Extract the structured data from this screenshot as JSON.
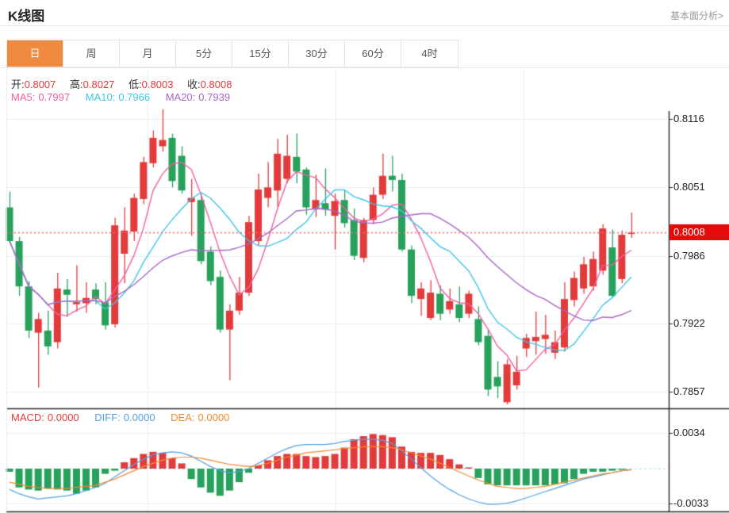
{
  "header": {
    "title": "K线图",
    "analysis_link": "基本面分析>"
  },
  "tabs": [
    {
      "label": "日",
      "active": true
    },
    {
      "label": "周",
      "active": false
    },
    {
      "label": "月",
      "active": false
    },
    {
      "label": "5分",
      "active": false
    },
    {
      "label": "15分",
      "active": false
    },
    {
      "label": "30分",
      "active": false
    },
    {
      "label": "60分",
      "active": false
    },
    {
      "label": "4时",
      "active": false
    }
  ],
  "readout": {
    "open_label": "开:",
    "open": "0.8007",
    "high_label": "高:",
    "high": "0.8027",
    "low_label": "低:",
    "low": "0.8003",
    "close_label": "收:",
    "close": "0.8008",
    "ma5_label": "MA5:",
    "ma5": "0.7997",
    "ma10_label": "MA10:",
    "ma10": "0.7966",
    "ma20_label": "MA20:",
    "ma20": "0.7939"
  },
  "macd_readout": {
    "macd_label": "MACD:",
    "macd": "0.0000",
    "diff_label": "DIFF:",
    "diff": "0.0000",
    "dea_label": "DEA:",
    "dea": "0.0000"
  },
  "colors": {
    "up": "#e23b3b",
    "down": "#27a15b",
    "ma5": "#f25fa5",
    "ma10": "#3ec6e8",
    "ma20": "#a866c8",
    "diff": "#55a0e0",
    "dea": "#f08a2c",
    "badge": "#e60b0b",
    "dotted_line": "#f56a6a",
    "grid": "#e7eef5",
    "zero_dash": "#aed6e8",
    "axis": "#333333",
    "frame": "#2b2b2b",
    "tab_active": "#ef8a3e",
    "link": "#999999"
  },
  "chart_data": {
    "type": "candlestick+macd",
    "title": "K线图",
    "legend": [
      "MA5",
      "MA10",
      "MA20",
      "MACD",
      "DIFF",
      "DEA"
    ],
    "grid": true,
    "price_axis_side": "right",
    "price_ticks": [
      {
        "label": "0.8116",
        "value": 0.8116
      },
      {
        "label": "0.8051",
        "value": 0.8051
      },
      {
        "label": "0.7986",
        "value": 0.7986
      },
      {
        "label": "0.7922",
        "value": 0.7922
      },
      {
        "label": "0.7857",
        "value": 0.7857
      }
    ],
    "last_price": {
      "label": "0.8008",
      "value": 0.8008
    },
    "macd_ticks": [
      {
        "label": "0.0034",
        "value": 0.0034
      },
      {
        "label": "-0.0033",
        "value": -0.0033
      }
    ],
    "ma_periods": [
      5,
      10,
      20
    ],
    "candles": [
      [
        0.8032,
        0.8047,
        0.7998,
        0.8
      ],
      [
        0.8,
        0.8004,
        0.7948,
        0.7957
      ],
      [
        0.7957,
        0.7962,
        0.7908,
        0.7915
      ],
      [
        0.7913,
        0.7932,
        0.7861,
        0.7926
      ],
      [
        0.7915,
        0.7934,
        0.7892,
        0.79
      ],
      [
        0.7904,
        0.797,
        0.7898,
        0.7955
      ],
      [
        0.7954,
        0.7964,
        0.7928,
        0.7949
      ],
      [
        0.794,
        0.7977,
        0.7933,
        0.7942
      ],
      [
        0.7941,
        0.7961,
        0.7932,
        0.7946
      ],
      [
        0.7954,
        0.796,
        0.794,
        0.7945
      ],
      [
        0.7942,
        0.7961,
        0.7916,
        0.792
      ],
      [
        0.7921,
        0.8022,
        0.7918,
        0.8015
      ],
      [
        0.7988,
        0.8032,
        0.796,
        0.801
      ],
      [
        0.8009,
        0.8045,
        0.8,
        0.8041
      ],
      [
        0.804,
        0.808,
        0.8035,
        0.8075
      ],
      [
        0.8074,
        0.8105,
        0.807,
        0.8098
      ],
      [
        0.809,
        0.8125,
        0.8085,
        0.8096
      ],
      [
        0.8098,
        0.8102,
        0.8051,
        0.8057
      ],
      [
        0.8081,
        0.809,
        0.8045,
        0.8048
      ],
      [
        0.8037,
        0.8059,
        0.8005,
        0.8041
      ],
      [
        0.8039,
        0.8045,
        0.7978,
        0.7981
      ],
      [
        0.799,
        0.7995,
        0.7958,
        0.7962
      ],
      [
        0.7966,
        0.7972,
        0.7913,
        0.7916
      ],
      [
        0.7916,
        0.794,
        0.7868,
        0.7934
      ],
      [
        0.7934,
        0.7966,
        0.793,
        0.7951
      ],
      [
        0.7951,
        0.8024,
        0.7948,
        0.8018
      ],
      [
        0.8,
        0.8064,
        0.7996,
        0.8049
      ],
      [
        0.8041,
        0.8075,
        0.8032,
        0.8051
      ],
      [
        0.8048,
        0.8097,
        0.8032,
        0.8083
      ],
      [
        0.8059,
        0.8101,
        0.8055,
        0.8081
      ],
      [
        0.808,
        0.8102,
        0.8055,
        0.8066
      ],
      [
        0.8068,
        0.807,
        0.8025,
        0.8032
      ],
      [
        0.803,
        0.8063,
        0.8023,
        0.8039
      ],
      [
        0.8036,
        0.8069,
        0.8024,
        0.803
      ],
      [
        0.8024,
        0.8045,
        0.7992,
        0.8038
      ],
      [
        0.8039,
        0.8048,
        0.8013,
        0.8017
      ],
      [
        0.802,
        0.8031,
        0.7982,
        0.7986
      ],
      [
        0.7984,
        0.8022,
        0.798,
        0.802
      ],
      [
        0.802,
        0.8051,
        0.8016,
        0.8044
      ],
      [
        0.8044,
        0.8083,
        0.804,
        0.8062
      ],
      [
        0.8062,
        0.8081,
        0.8047,
        0.8058
      ],
      [
        0.8058,
        0.8064,
        0.799,
        0.7992
      ],
      [
        0.7992,
        0.7996,
        0.7941,
        0.7948
      ],
      [
        0.7945,
        0.7961,
        0.7929,
        0.7955
      ],
      [
        0.7927,
        0.7963,
        0.7925,
        0.7951
      ],
      [
        0.795,
        0.7958,
        0.7925,
        0.7931
      ],
      [
        0.7935,
        0.7955,
        0.7931,
        0.7943
      ],
      [
        0.794,
        0.7957,
        0.7923,
        0.7927
      ],
      [
        0.7931,
        0.7953,
        0.7927,
        0.795
      ],
      [
        0.7926,
        0.7938,
        0.7901,
        0.7904
      ],
      [
        0.791,
        0.7916,
        0.7853,
        0.7859
      ],
      [
        0.7871,
        0.7886,
        0.7851,
        0.7862
      ],
      [
        0.7847,
        0.7888,
        0.7845,
        0.7883
      ],
      [
        0.7863,
        0.7891,
        0.7859,
        0.7876
      ],
      [
        0.7898,
        0.7912,
        0.789,
        0.7908
      ],
      [
        0.7905,
        0.7933,
        0.7892,
        0.7909
      ],
      [
        0.7907,
        0.793,
        0.7893,
        0.7911
      ],
      [
        0.7894,
        0.7915,
        0.7888,
        0.7904
      ],
      [
        0.7899,
        0.7961,
        0.7895,
        0.7945
      ],
      [
        0.7944,
        0.7971,
        0.7938,
        0.7965
      ],
      [
        0.7955,
        0.7985,
        0.795,
        0.7978
      ],
      [
        0.7957,
        0.799,
        0.7953,
        0.7983
      ],
      [
        0.7972,
        0.8016,
        0.7968,
        0.8012
      ],
      [
        0.7994,
        0.8011,
        0.7946,
        0.7948
      ],
      [
        0.7964,
        0.801,
        0.796,
        0.8006
      ],
      [
        0.8007,
        0.8027,
        0.8003,
        0.8008
      ]
    ],
    "macd": {
      "hist": [
        -0.0003,
        -0.0018,
        -0.002,
        -0.0021,
        -0.0019,
        -0.002,
        -0.0021,
        -0.0024,
        -0.0021,
        -0.0018,
        -0.0005,
        -0.0002,
        0.0006,
        0.001,
        0.0014,
        0.0016,
        0.0015,
        0.001,
        0.0005,
        -0.001,
        -0.0018,
        -0.0023,
        -0.0026,
        -0.0021,
        -0.0013,
        -0.0004,
        0.0003,
        0.0008,
        0.0012,
        0.0014,
        0.0014,
        0.0012,
        0.0011,
        0.0012,
        0.0014,
        0.002,
        0.0028,
        0.0031,
        0.0033,
        0.0032,
        0.003,
        0.0021,
        0.0016,
        0.0015,
        0.0015,
        0.0013,
        0.0009,
        0.0004,
        0.0001,
        -0.0009,
        -0.0015,
        -0.0016,
        -0.0016,
        -0.0016,
        -0.0016,
        -0.0016,
        -0.0016,
        -0.0015,
        -0.0014,
        -0.001,
        -0.0005,
        -0.0003,
        -0.0003,
        -0.0002,
        -0.0001,
        0.0
      ],
      "diff": [
        -0.002,
        -0.0024,
        -0.0027,
        -0.0029,
        -0.0028,
        -0.0027,
        -0.0026,
        -0.0024,
        -0.0021,
        -0.0018,
        -0.0014,
        -0.0008,
        -0.0002,
        0.0004,
        0.0009,
        0.0013,
        0.0015,
        0.0016,
        0.0015,
        0.0012,
        0.0007,
        0.0002,
        -0.0002,
        -0.0004,
        -0.0003,
        0.0,
        0.0005,
        0.001,
        0.0015,
        0.0019,
        0.0022,
        0.0023,
        0.0023,
        0.0023,
        0.0024,
        0.0026,
        0.0027,
        0.0028,
        0.0028,
        0.0027,
        0.0024,
        0.0017,
        0.0009,
        0.0001,
        -0.0007,
        -0.0014,
        -0.002,
        -0.0025,
        -0.0029,
        -0.0032,
        -0.0034,
        -0.0034,
        -0.0033,
        -0.0031,
        -0.0028,
        -0.0025,
        -0.0022,
        -0.0019,
        -0.0016,
        -0.0013,
        -0.001,
        -0.0008,
        -0.0006,
        -0.0004,
        -0.0002,
        -0.0001
      ],
      "dea": [
        -0.0013,
        -0.0015,
        -0.0017,
        -0.0018,
        -0.0019,
        -0.0019,
        -0.0019,
        -0.0018,
        -0.0017,
        -0.0016,
        -0.0013,
        -0.001,
        -0.0006,
        -0.0002,
        0.0002,
        0.0005,
        0.0008,
        0.001,
        0.0011,
        0.0011,
        0.001,
        0.0008,
        0.0006,
        0.0004,
        0.0003,
        0.0002,
        0.0003,
        0.0005,
        0.0008,
        0.0011,
        0.0013,
        0.0015,
        0.0016,
        0.0017,
        0.0018,
        0.0019,
        0.002,
        0.0021,
        0.0021,
        0.0021,
        0.002,
        0.0018,
        0.0015,
        0.0012,
        0.0009,
        0.0005,
        0.0001,
        -0.0003,
        -0.0007,
        -0.0011,
        -0.0014,
        -0.0017,
        -0.0018,
        -0.0019,
        -0.0019,
        -0.0018,
        -0.0017,
        -0.0015,
        -0.0013,
        -0.0011,
        -0.0009,
        -0.0007,
        -0.0005,
        -0.0004,
        -0.0002,
        -0.0001
      ]
    }
  }
}
